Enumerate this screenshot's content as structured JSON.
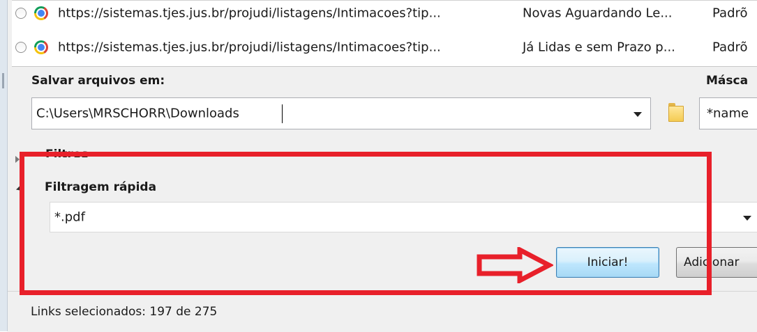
{
  "downloads_list": {
    "rows": [
      {
        "url": "https://sistemas.tjes.jus.br/projudi/listagens/Intimacoes?tip...",
        "description": "Novas Aguardando Le...",
        "mask": "Padrõ"
      },
      {
        "url": "https://sistemas.tjes.jus.br/projudi/listagens/Intimacoes?tip...",
        "description": "Já Lidas e sem Prazo p...",
        "mask": "Padrõ"
      }
    ]
  },
  "save_section": {
    "label": "Salvar arquivos em:",
    "path_value": "C:\\Users\\MRSCHORR\\Downloads",
    "mask_label": "Másca",
    "mask_value": "*name"
  },
  "filters": {
    "label": "Filtros",
    "quick_filter_label": "Filtragem rápida",
    "quick_filter_value": "*.pdf"
  },
  "buttons": {
    "start_label": "Iniciar!",
    "add_label": "Adicionar"
  },
  "status": {
    "text": "Links selecionados: 197 de 275"
  },
  "colors": {
    "annotation": "#e8202a",
    "primary_button_border": "#3c7fb1"
  }
}
